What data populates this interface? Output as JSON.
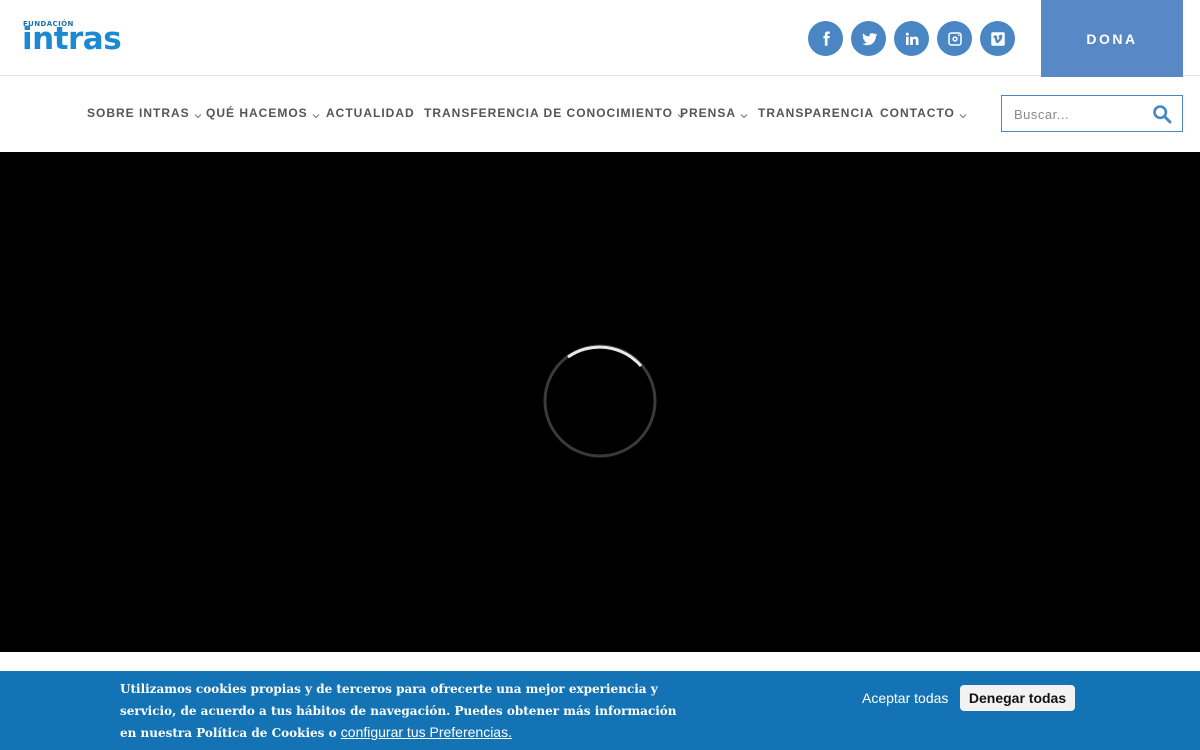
{
  "brand": {
    "small": "FUNDACIÓN",
    "name": "intras",
    "color": "#1b8ad0"
  },
  "social": [
    {
      "name": "facebook-icon"
    },
    {
      "name": "twitter-icon"
    },
    {
      "name": "linkedin-icon"
    },
    {
      "name": "instagram-icon"
    },
    {
      "name": "vimeo-icon"
    }
  ],
  "donate_label": "DONA",
  "nav": {
    "items": [
      {
        "label": "SOBRE INTRAS",
        "dropdown": true
      },
      {
        "label": "QUÉ HACEMOS",
        "dropdown": true
      },
      {
        "label": "ACTUALIDAD",
        "dropdown": false
      },
      {
        "label": "TRANSFERENCIA DE CONOCIMIENTO",
        "dropdown": true
      },
      {
        "label": "PRENSA",
        "dropdown": true
      },
      {
        "label": "TRANSPARENCIA",
        "dropdown": false
      },
      {
        "label": "CONTACTO",
        "dropdown": true
      }
    ]
  },
  "search": {
    "placeholder": "Buscar..."
  },
  "hero": {
    "state": "loading"
  },
  "cookie": {
    "text": "Utilizamos cookies propias y de terceros para ofrecerte una mejor experiencia y servicio, de acuerdo a tus hábitos de navegación. Puedes obtener más información en nuestra Política de Cookies o",
    "link_label": "configurar tus Preferencias.",
    "accept_label": "Aceptar todas",
    "deny_label": "Denegar todas"
  },
  "colors": {
    "accent": "#4a86c4",
    "cookie_bar": "#1473b4",
    "donate": "#5889c6"
  }
}
